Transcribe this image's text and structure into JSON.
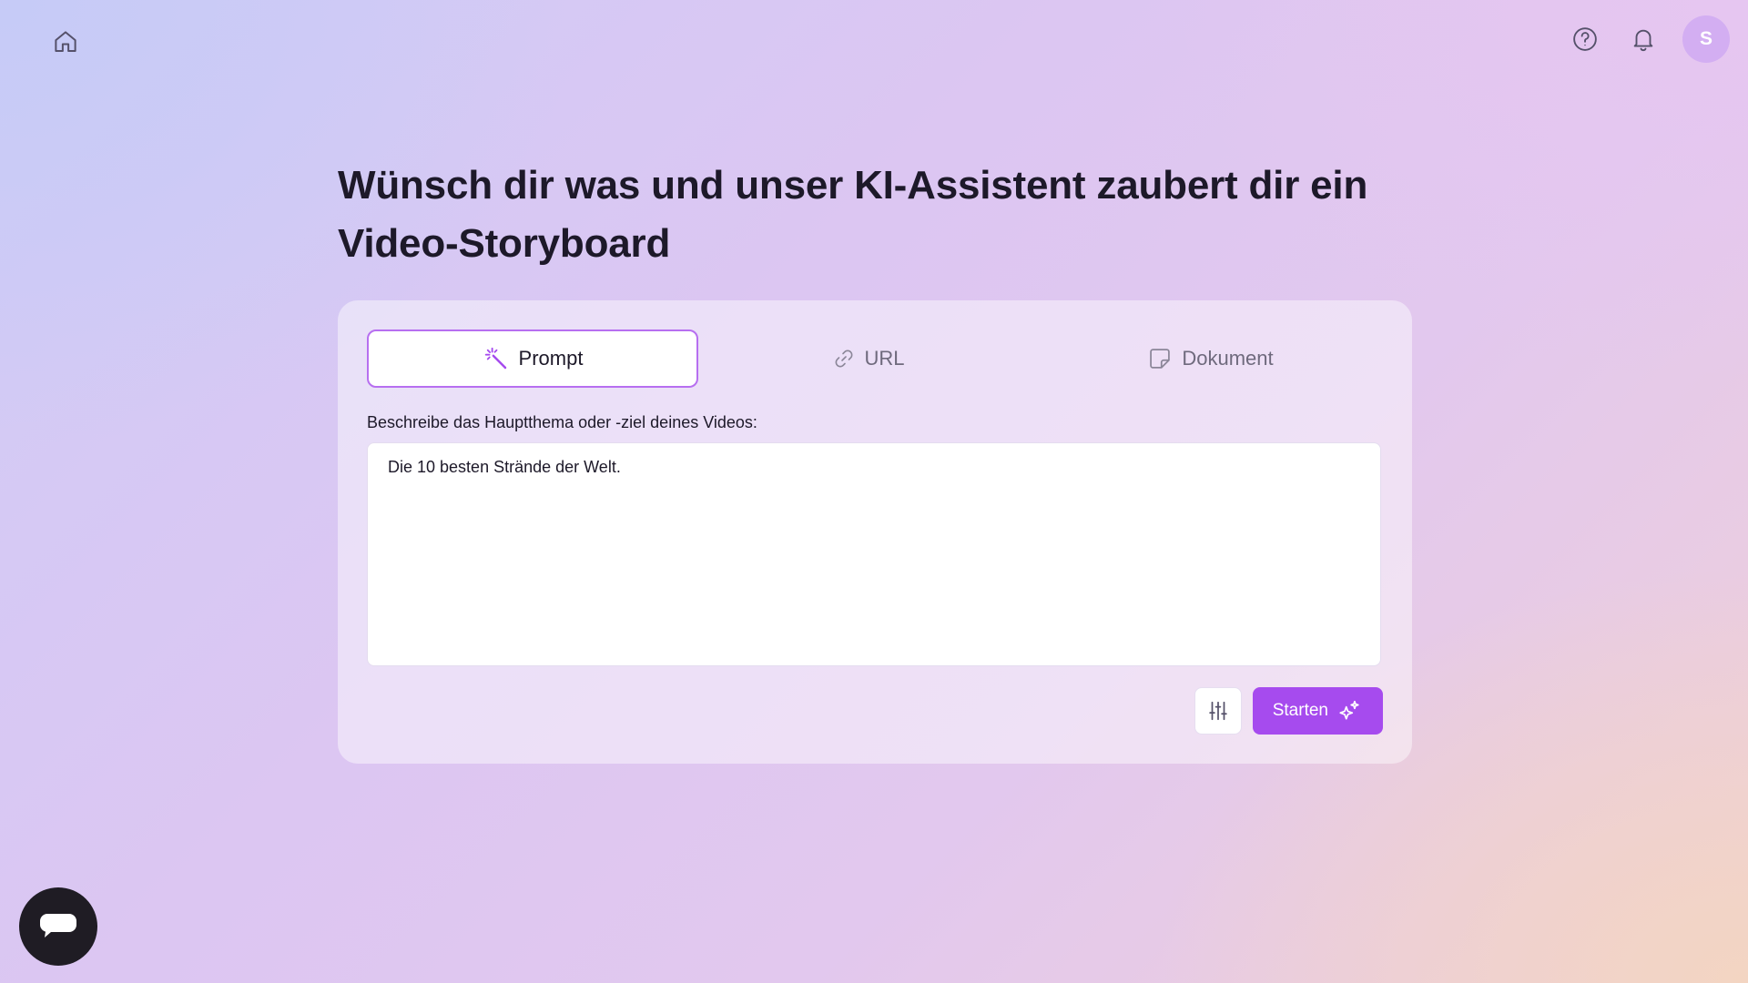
{
  "topbar": {
    "home_icon": "home-icon",
    "help_icon": "question-circle-icon",
    "notifications_icon": "bell-icon",
    "avatar_initial": "S"
  },
  "headline": "Wünsch dir was und unser KI-Assistent zaubert dir ein Video-Storyboard",
  "tabs": [
    {
      "label": "Prompt",
      "icon": "magic-wand-icon",
      "active": true
    },
    {
      "label": "URL",
      "icon": "link-icon",
      "active": false
    },
    {
      "label": "Dokument",
      "icon": "document-icon",
      "active": false
    }
  ],
  "prompt": {
    "label": "Beschreibe das Hauptthema oder -ziel deines Videos:",
    "value": "Die 10 besten Strände der Welt."
  },
  "actions": {
    "settings_icon": "sliders-icon",
    "start_label": "Starten",
    "start_icon": "sparkles-icon"
  },
  "chat": {
    "icon": "chat-bubble-icon"
  },
  "colors": {
    "accent": "#a64bee",
    "active_tab_border": "#b76ff0",
    "avatar_bg": "#d3aef2",
    "chat_bg": "#1f1c24"
  }
}
